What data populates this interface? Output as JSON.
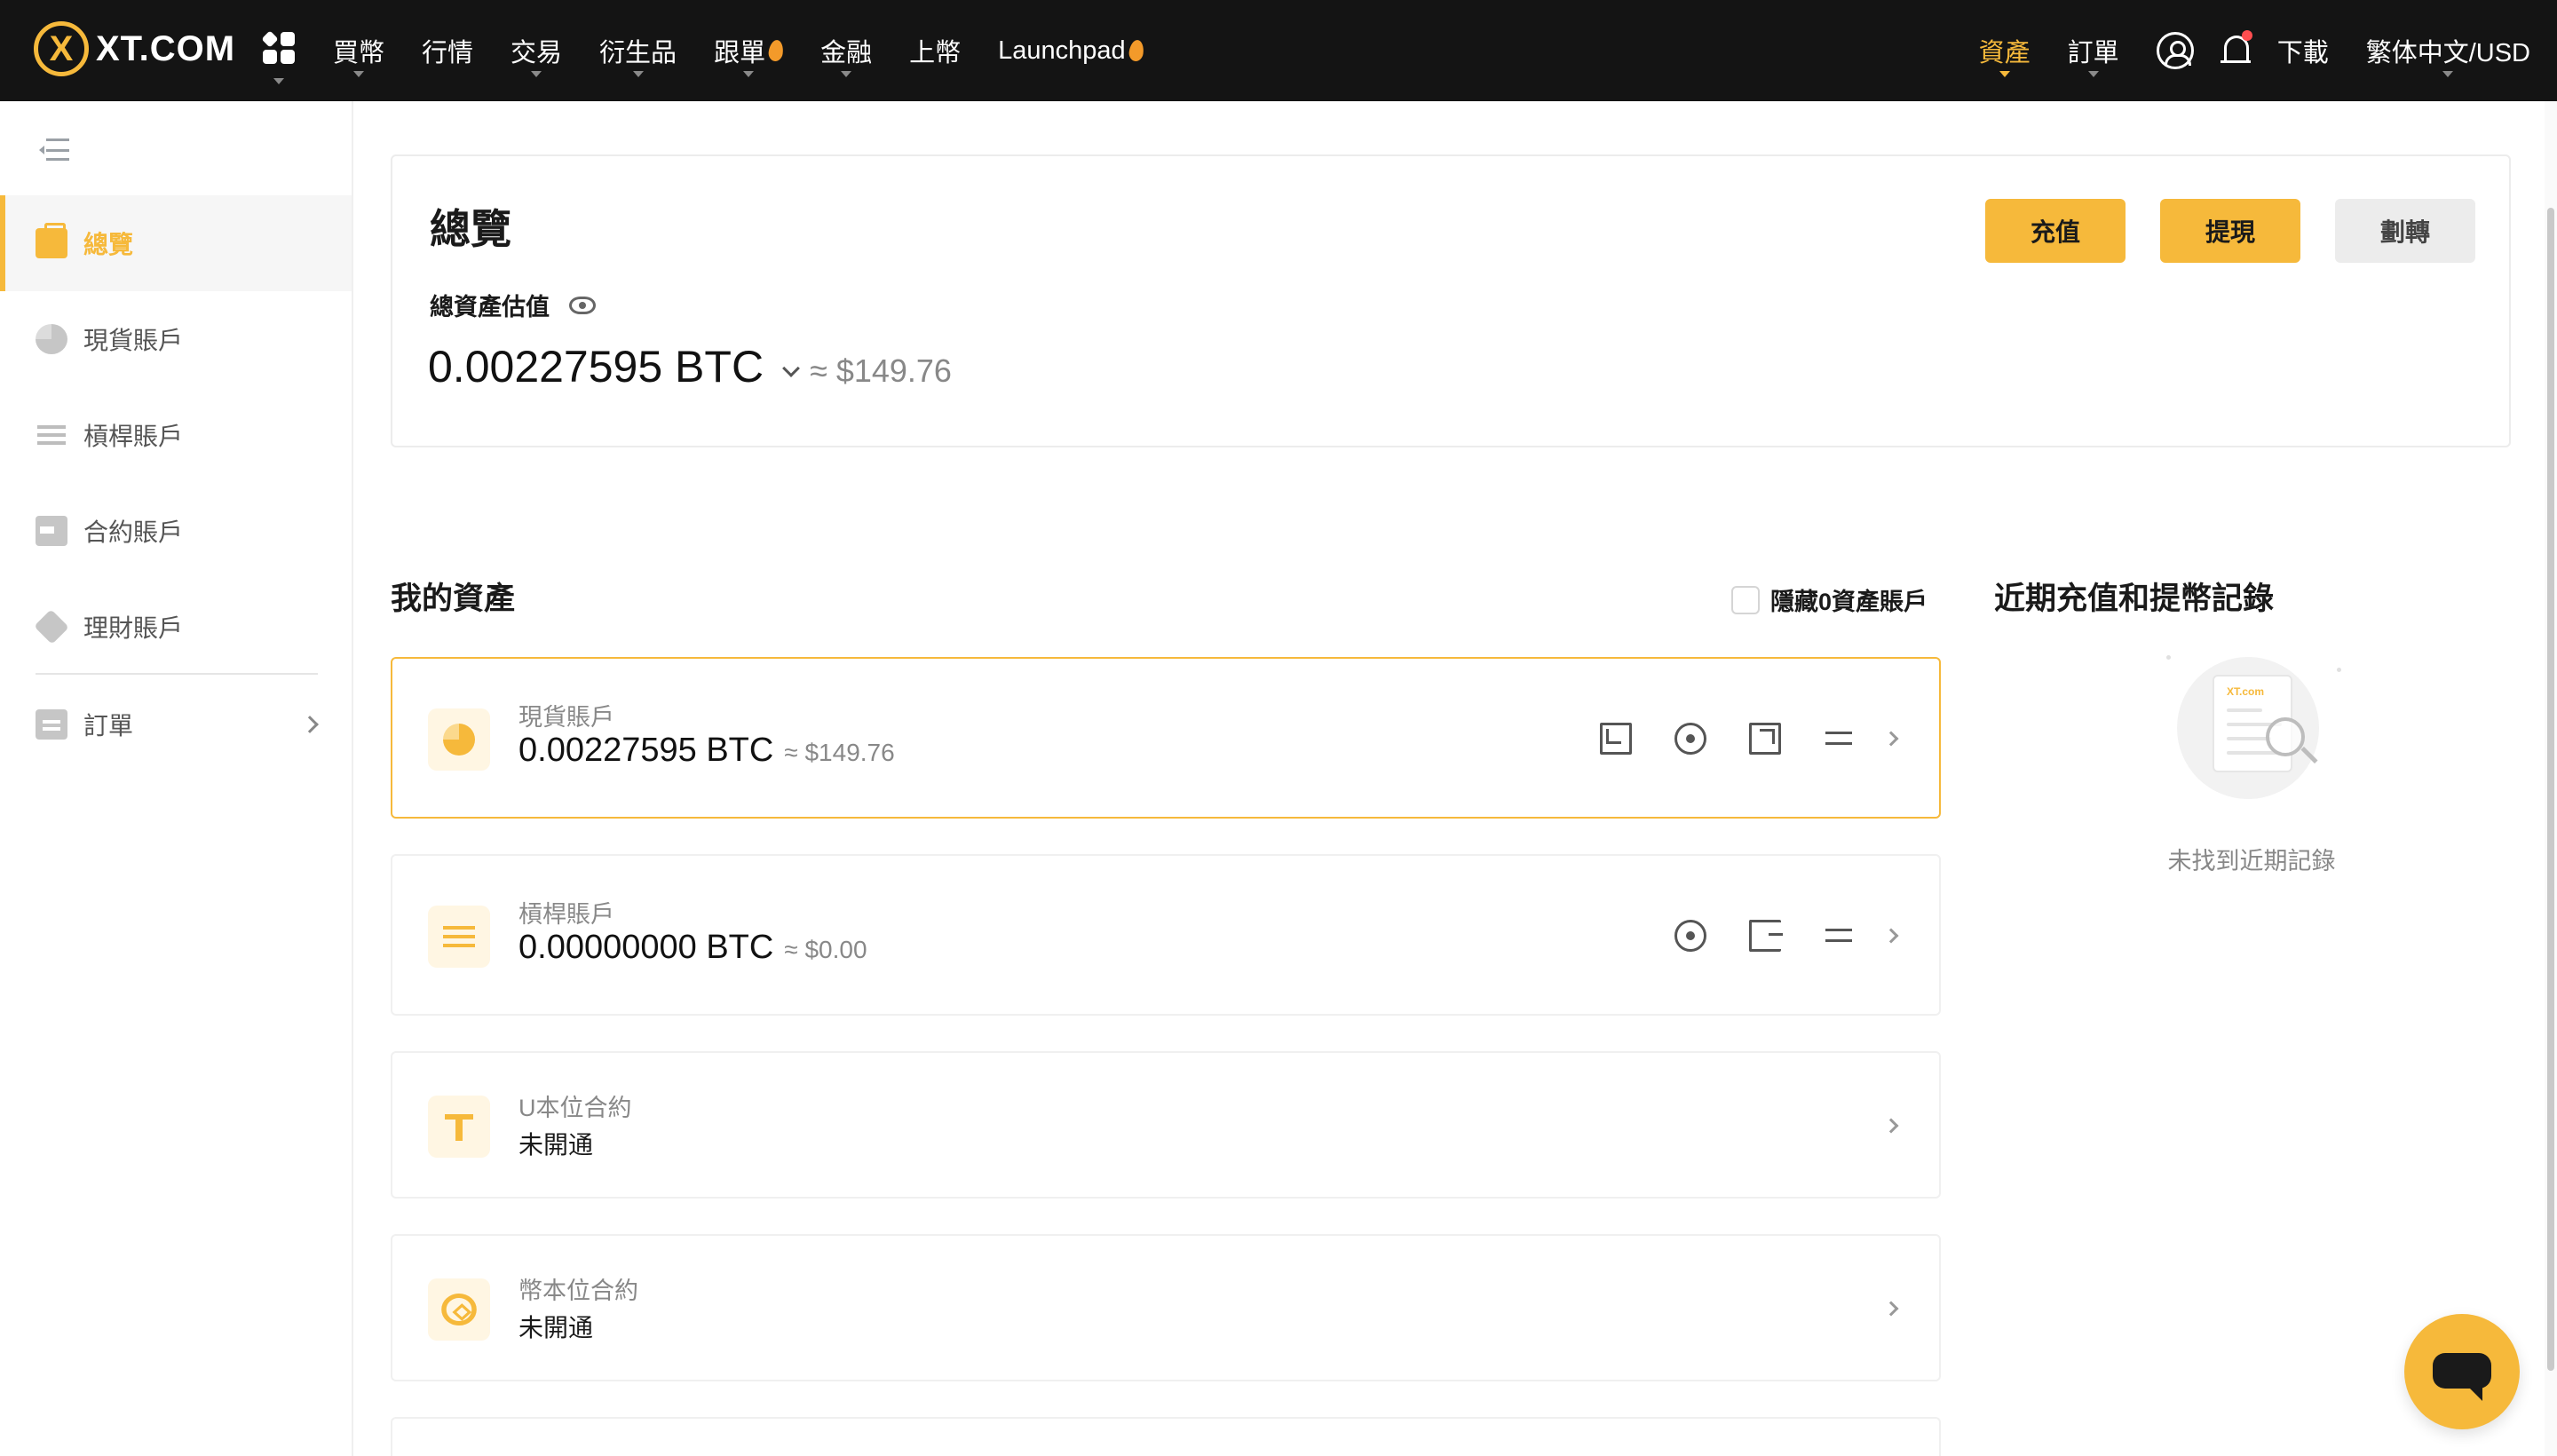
{
  "brand": {
    "logo_mark": "X",
    "logo_text": "XT.COM",
    "accent_color": "#f6b93b"
  },
  "nav": {
    "items": [
      {
        "label": "買幣",
        "dropdown": true,
        "hot": false
      },
      {
        "label": "行情",
        "dropdown": false,
        "hot": false
      },
      {
        "label": "交易",
        "dropdown": true,
        "hot": false
      },
      {
        "label": "衍生品",
        "dropdown": true,
        "hot": false
      },
      {
        "label": "跟單",
        "dropdown": true,
        "hot": true
      },
      {
        "label": "金融",
        "dropdown": true,
        "hot": false
      },
      {
        "label": "上幣",
        "dropdown": false,
        "hot": false
      },
      {
        "label": "Launchpad",
        "dropdown": false,
        "hot": true
      }
    ],
    "right": {
      "assets": "資產",
      "orders": "訂單",
      "download": "下載",
      "language": "繁体中文/USD"
    }
  },
  "sidebar": {
    "items": [
      {
        "label": "總覽",
        "icon": "wallet-icon",
        "active": true
      },
      {
        "label": "現貨賬戶",
        "icon": "pie-chart-icon",
        "active": false
      },
      {
        "label": "槓桿賬戶",
        "icon": "sliders-icon",
        "active": false
      },
      {
        "label": "合約賬戶",
        "icon": "card-icon",
        "active": false
      },
      {
        "label": "理財賬戶",
        "icon": "diamond-icon",
        "active": false
      }
    ],
    "orders": {
      "label": "訂單",
      "icon": "clipboard-icon"
    }
  },
  "overview": {
    "title": "總覽",
    "estimate_label": "總資產估值",
    "btc_value": "0.00227595 BTC",
    "usd_value": "≈ $149.76",
    "buttons": {
      "deposit": "充值",
      "withdraw": "提現",
      "transfer": "劃轉"
    }
  },
  "my_assets": {
    "title": "我的資產",
    "hide_zero_label": "隱藏0資產賬戶",
    "accounts": [
      {
        "name": "現貨賬戶",
        "balance": "0.00227595 BTC",
        "usd": "≈ $149.76"
      },
      {
        "name": "槓桿賬戶",
        "balance": "0.00000000 BTC",
        "usd": "≈ $0.00"
      },
      {
        "name": "U本位合約",
        "status": "未開通"
      },
      {
        "name": "幣本位合約",
        "status": "未開通"
      }
    ]
  },
  "recent": {
    "title": "近期充值和提幣記錄",
    "empty_text": "未找到近期記錄",
    "illus_logo": "XT.com"
  }
}
